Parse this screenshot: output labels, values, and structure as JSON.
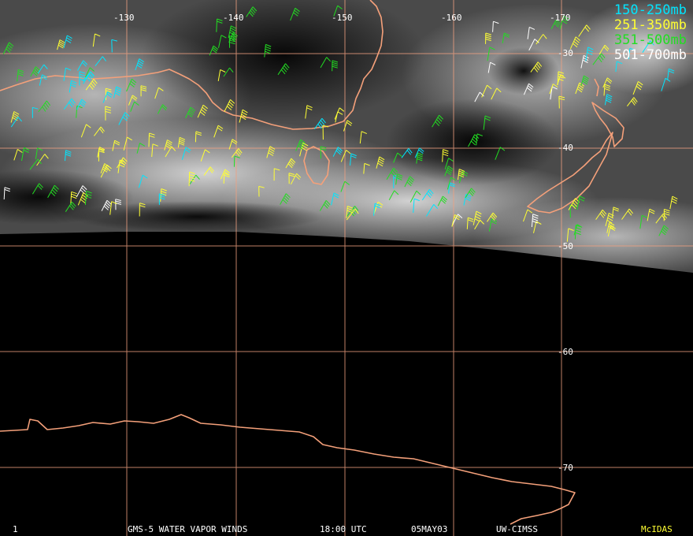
{
  "map": {
    "longitude_labels": [
      "-130",
      "-140",
      "-150",
      "-160",
      "-170"
    ],
    "latitude_labels": [
      "-30",
      "-40",
      "-50",
      "-60",
      "-70"
    ]
  },
  "legend": {
    "items": [
      {
        "label": "150-250mb",
        "color": "#00e5ff"
      },
      {
        "label": "251-350mb",
        "color": "#ffff33"
      },
      {
        "label": "351-500mb",
        "color": "#22dd22"
      },
      {
        "label": "501-700mb",
        "color": "#ffffff"
      }
    ]
  },
  "footer": {
    "frame": "1",
    "product": "GMS-5 WATER VAPOR WINDS",
    "time": "18:00 UTC",
    "date": "05MAY03",
    "source": "UW-CIMSS",
    "software": "McIDAS"
  },
  "colors": {
    "coastline": "#f4a07a",
    "grid": "#f0a080",
    "software_label": "#ffff33"
  }
}
